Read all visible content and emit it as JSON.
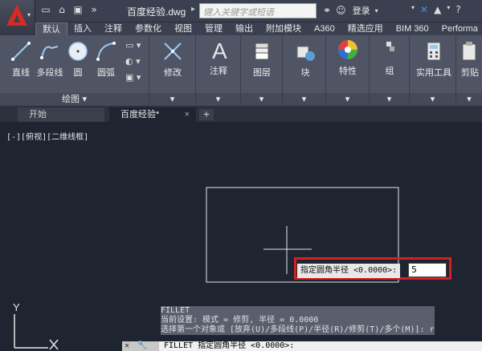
{
  "titlebar": {
    "doc_title": "百度经验.dwg",
    "search_placeholder": "键入关键字或短语",
    "login_label": "登录"
  },
  "ribbon_tabs": [
    "默认",
    "插入",
    "注释",
    "参数化",
    "视图",
    "管理",
    "输出",
    "附加模块",
    "A360",
    "精选应用",
    "BIM 360",
    "Performa"
  ],
  "draw_panel": {
    "tools": [
      "直线",
      "多段线",
      "圆",
      "圆弧"
    ],
    "footer": "绘图 ▾"
  },
  "panels": [
    {
      "label": "修改",
      "icon": "move-icon"
    },
    {
      "label": "注释",
      "icon": "text-a-icon"
    },
    {
      "label": "图层",
      "icon": "layers-icon"
    },
    {
      "label": "块",
      "icon": "block-icon"
    },
    {
      "label": "特性",
      "icon": "color-wheel-icon"
    },
    {
      "label": "组",
      "icon": "group-icon"
    },
    {
      "label": "实用工具",
      "icon": "calculator-icon"
    },
    {
      "label": "剪贴",
      "icon": "clipboard-icon"
    }
  ],
  "file_tabs": {
    "start": "开始",
    "doc": "百度经验*",
    "close": "×",
    "add": "+"
  },
  "viewport_label": "[-][俯视][二维线框]",
  "ucs": {
    "y": "Y",
    "x": "X"
  },
  "prompt": {
    "label": "指定圆角半径 <0.0000>:",
    "value": "5"
  },
  "command_history": [
    "FILLET",
    "当前设置: 模式 = 修剪, 半径 = 0.0000",
    "选择第一个对象或 [放弃(U)/多段线(P)/半径(R)/修剪(T)/多个(M)]: r"
  ],
  "command_line": {
    "buttons": "✕ 🔧 ⌕",
    "text": "FILLET 指定圆角半径 <0.0000>:"
  },
  "colors": {
    "accent_red": "#d42020",
    "canvas": "#1e2430",
    "ribbon": "#4f5565"
  }
}
